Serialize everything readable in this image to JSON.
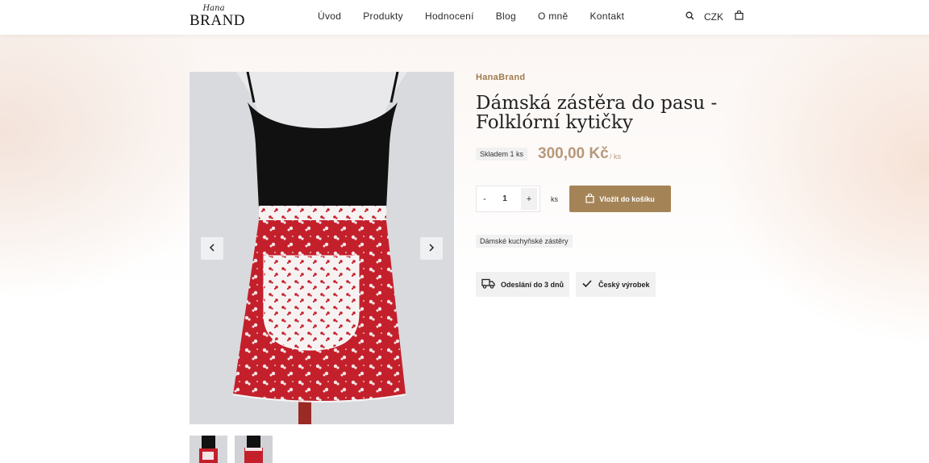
{
  "header": {
    "logo_script": "Hana",
    "logo_brand": "BRAND",
    "nav": [
      "Úvod",
      "Produkty",
      "Hodnocení",
      "Blog",
      "O mně",
      "Kontakt"
    ],
    "currency": "CZK",
    "icons": [
      "search-icon",
      "shopping-bag-icon"
    ]
  },
  "gallery": {
    "arrows": [
      "chevron-left-icon",
      "chevron-right-icon"
    ],
    "thumbnail_count": 2
  },
  "product": {
    "brand": "HanaBrand",
    "title": "Dámská zástěra do pasu - Folklórní kytičky",
    "stock": "Skladem 1 ks",
    "price": "300,00 Kč",
    "price_unit": "/ ks",
    "quantity": {
      "minus": "-",
      "value": "1",
      "plus": "+",
      "unit": "ks"
    },
    "add_to_cart_label": "Vložit do košíku",
    "category_tag": "Dámské kuchyňské zástěry",
    "features": [
      "Odeslání do 3 dnů",
      "Český výrobek"
    ]
  },
  "colors": {
    "accent_brown": "#a48457",
    "price_color": "#b8987a",
    "brand_text": "#a07b4f",
    "apron_red": "#c3202c"
  }
}
